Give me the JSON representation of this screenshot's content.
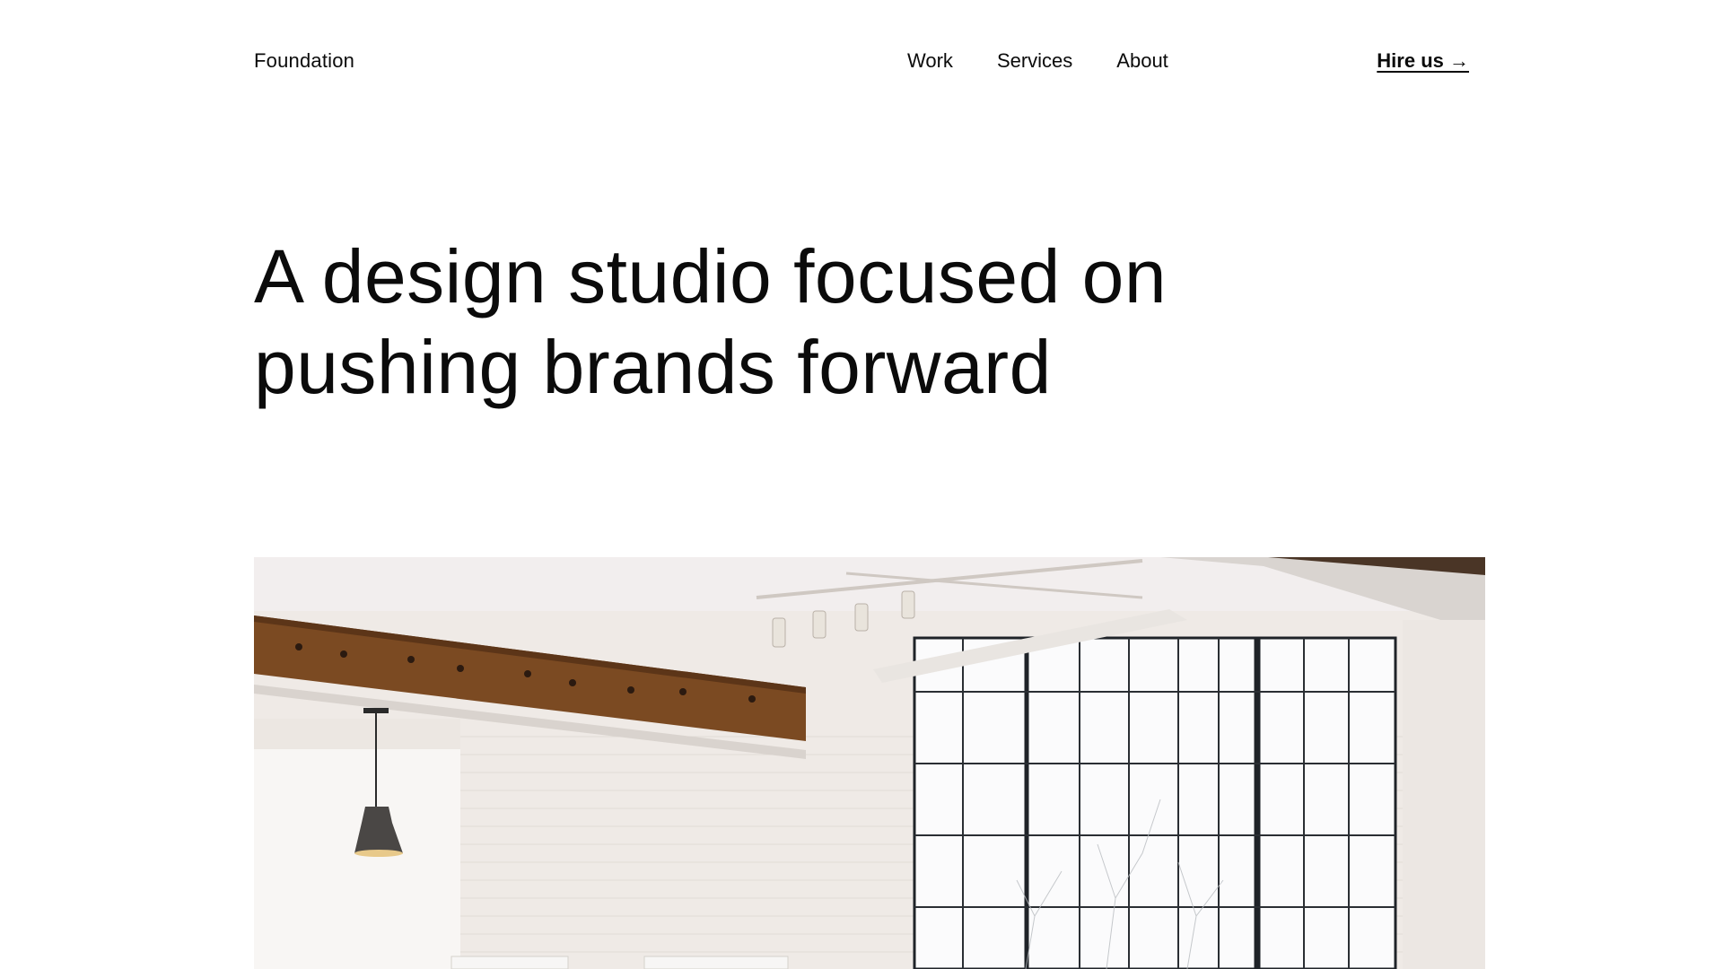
{
  "header": {
    "logo": "Foundation",
    "nav": [
      {
        "label": "Work"
      },
      {
        "label": "Services"
      },
      {
        "label": "About"
      }
    ],
    "cta": "Hire us →"
  },
  "hero": {
    "line1": "A design studio focused on",
    "line2": "pushing brands forward"
  },
  "image": {
    "subject": "bright loft studio interior with brick walls, wooden beam, track lights, pendant lamp and large steel-framed windows"
  }
}
